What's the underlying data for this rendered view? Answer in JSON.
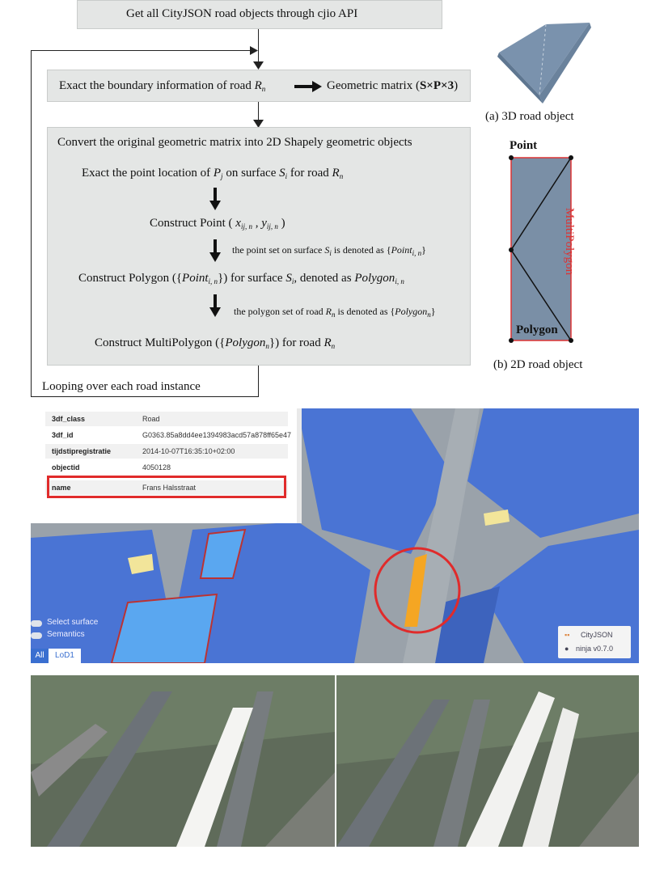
{
  "flowchart": {
    "step1": "Get all CityJSON road objects through cjio API",
    "step2": {
      "text": "Exact the boundary information of road ",
      "var": "R",
      "sub": "n",
      "result_prefix": "Geometric matrix (",
      "result_bold": "S×P×3",
      "result_suffix": ")"
    },
    "step3": {
      "title": "Convert the original geometric matrix into 2D Shapely geometric objects",
      "line1": {
        "a": "Exact the point location of ",
        "v1": "P",
        "s1": "j",
        "b": " on surface ",
        "v2": "S",
        "s2": "i",
        "c": " for road ",
        "v3": "R",
        "s3": "n"
      },
      "line2": {
        "a": "Construct Point ( ",
        "v1": "x",
        "s1": "ij, n",
        "b": " , ",
        "v2": "y",
        "s2": "ij, n",
        "c": " )"
      },
      "note1": {
        "a": "the point set on surface ",
        "v1": "S",
        "s1": "i",
        "b": " is denoted as {",
        "v2": "Point",
        "s2": "i, n",
        "c": "}"
      },
      "line3": {
        "a": "Construct Polygon ({",
        "v1": "Point",
        "s1": "i, n",
        "b": "}) for surface ",
        "v2": "S",
        "s2": "i",
        "c": ", denoted as ",
        "v3": "Polygon",
        "s3": "i, n"
      },
      "note2": {
        "a": "the polygon set of road ",
        "v1": "R",
        "s1": "n",
        "b": "  is denoted as {",
        "v2": "Polygon",
        "s2": "n",
        "c": "}"
      },
      "line4": {
        "a": "Construct MultiPolygon ({",
        "v1": "Polygon",
        "s1": "n",
        "b": "}) for road ",
        "v2": "R",
        "s2": "n"
      }
    },
    "loop_label": "Looping over each road instance"
  },
  "figure_labels": {
    "caption_a": "(a) 3D road object",
    "caption_b": "(b) 2D road object",
    "point_label": "Point",
    "polygon_label": "Polygon",
    "multipolygon_label": "MultiPolygon"
  },
  "viewer": {
    "attributes": [
      {
        "key": "3df_class",
        "value": "Road"
      },
      {
        "key": "3df_id",
        "value": "G0363.85a8dd4ee1394983acd57a878ff65e47"
      },
      {
        "key": "tijdstipregistratie",
        "value": "2014-10-07T16:35:10+02:00"
      },
      {
        "key": "objectid",
        "value": "4050128"
      },
      {
        "key": "name",
        "value": "Frans Halsstraat"
      }
    ],
    "toggle_select_surface": "Select surface",
    "toggle_semantics": "Semantics",
    "btn_all": "All",
    "btn_lod": "LoD1",
    "brand_name": "CityJSON",
    "brand_version": "ninja v0.7.0",
    "colors": {
      "building": "#4a74d4",
      "road": "#9aa0a6",
      "highlight": "#f5a623",
      "marker": "#e02b2b"
    }
  }
}
